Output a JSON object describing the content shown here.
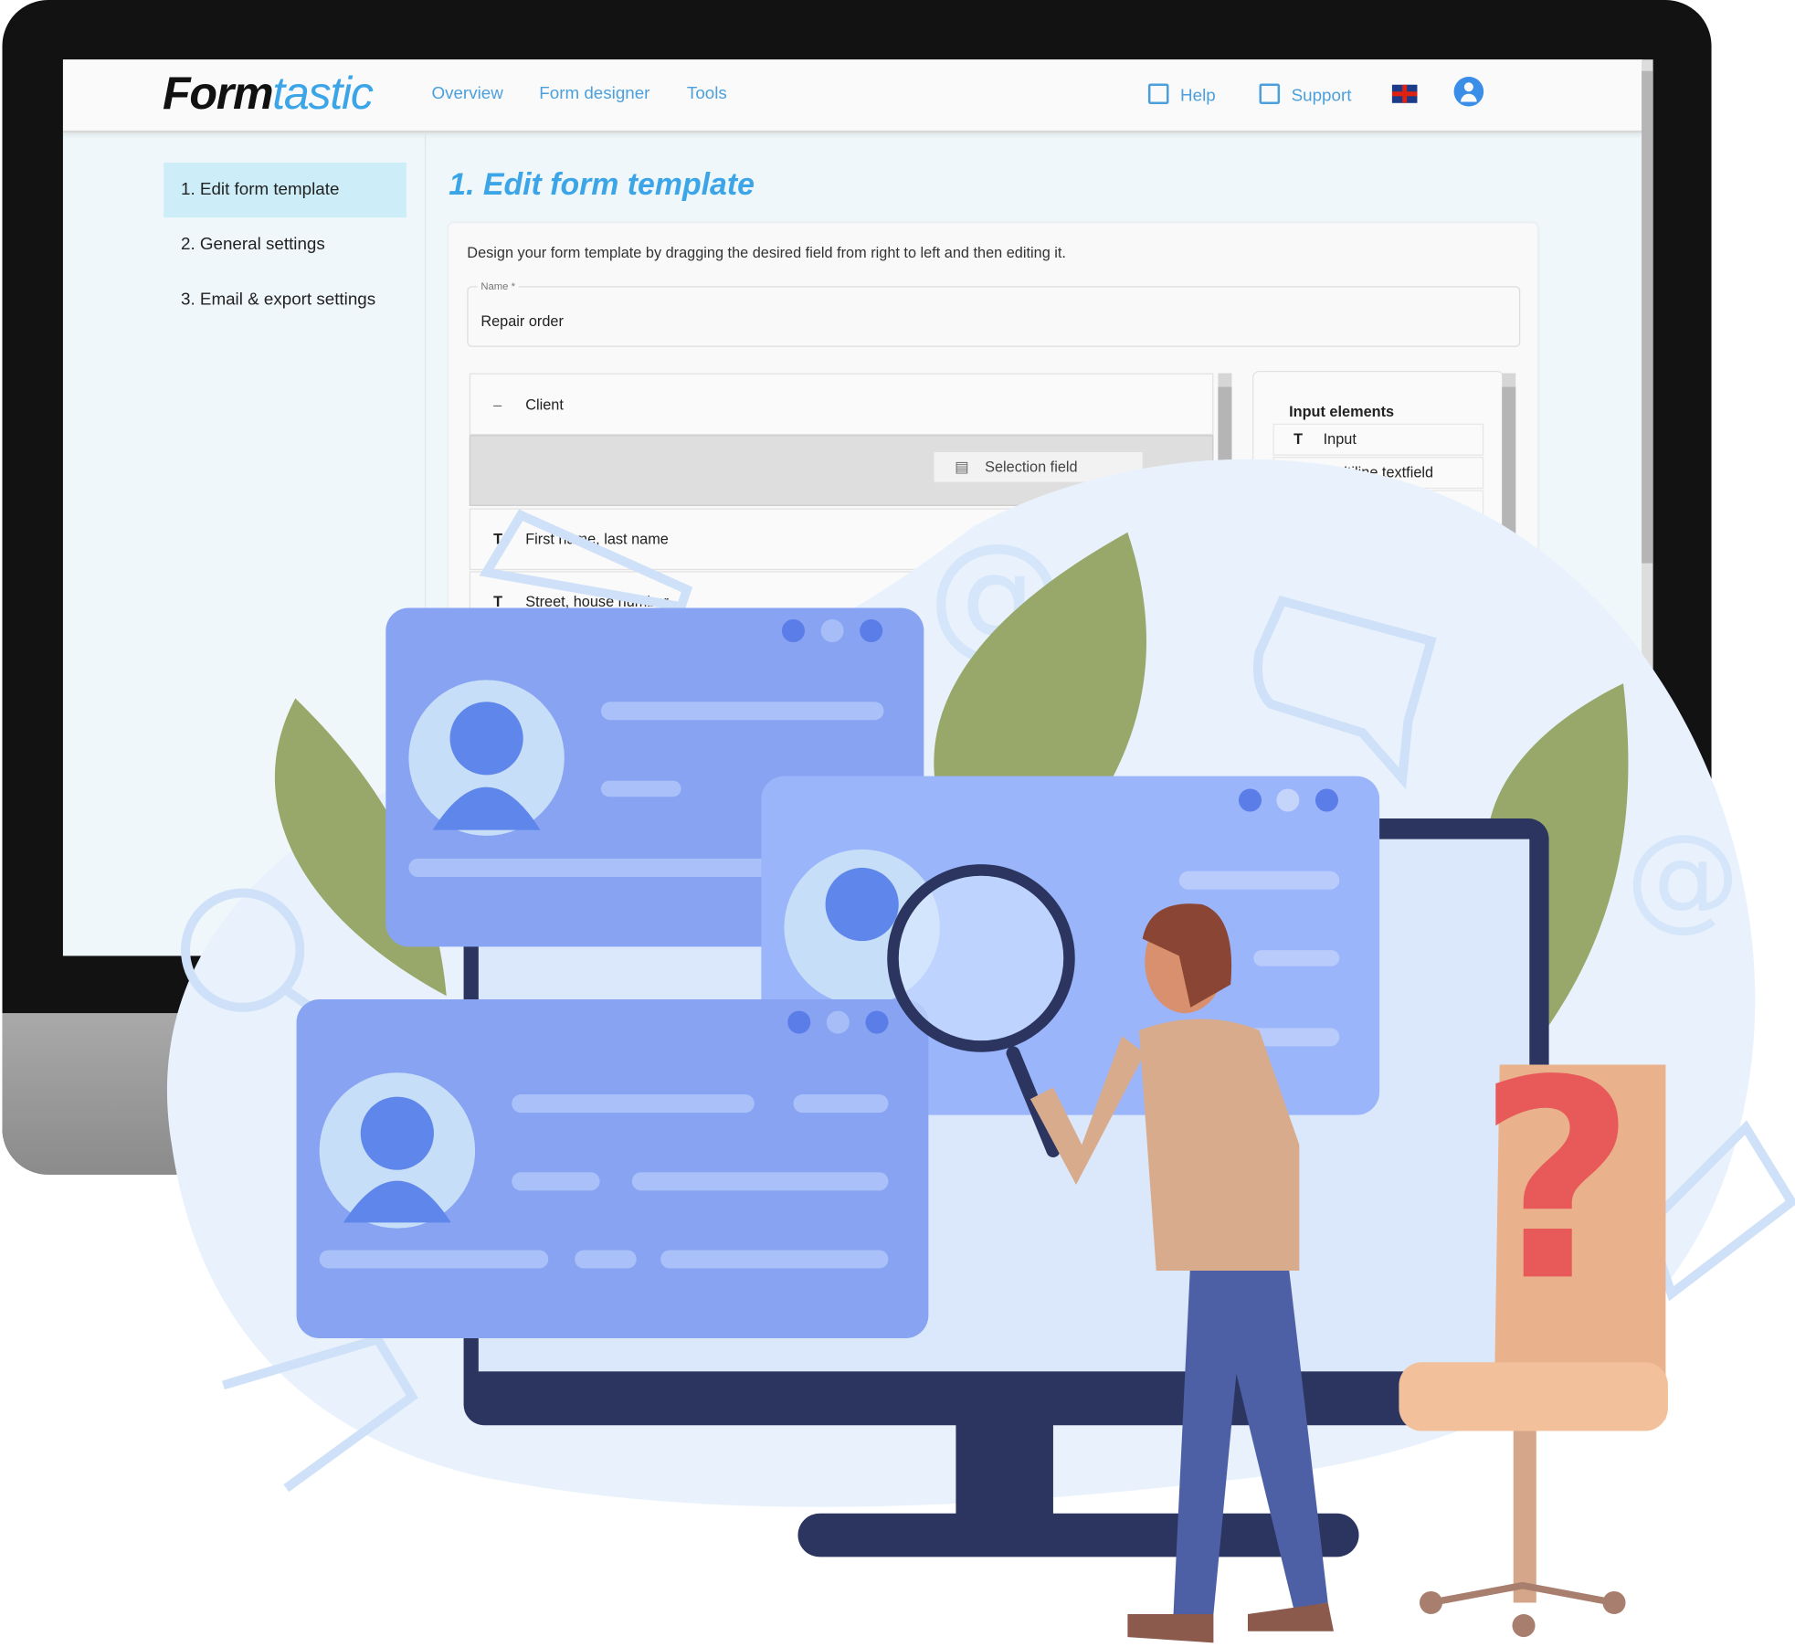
{
  "header": {
    "logo": {
      "part1": "Form",
      "part2": "tastic"
    },
    "nav": [
      "Overview",
      "Form designer",
      "Tools"
    ],
    "help_label": "Help",
    "support_label": "Support",
    "language_icon": "uk-flag-icon",
    "account_icon": "user-circle-icon"
  },
  "sidebar": {
    "items": [
      {
        "label": "1. Edit form template",
        "active": true
      },
      {
        "label": "2. General settings"
      },
      {
        "label": "3. Email & export settings"
      }
    ]
  },
  "main": {
    "title": "1. Edit form template",
    "description": "Design your form template by dragging the desired field from right to left and then editing it.",
    "name_field": {
      "label": "Name *",
      "value": "Repair order"
    },
    "form_tree": {
      "group_label": "Client",
      "dragged_item": "Selection field",
      "fields": [
        "First name, last name",
        "Street, house number"
      ]
    },
    "palette": {
      "heading": "Input elements",
      "items": [
        "Input",
        "Multiline textfield"
      ]
    }
  },
  "colors": {
    "accent": "#3ba5e8",
    "window_blue": "#87a3f2",
    "leaf": "#98a86a",
    "navy": "#2b3560"
  }
}
